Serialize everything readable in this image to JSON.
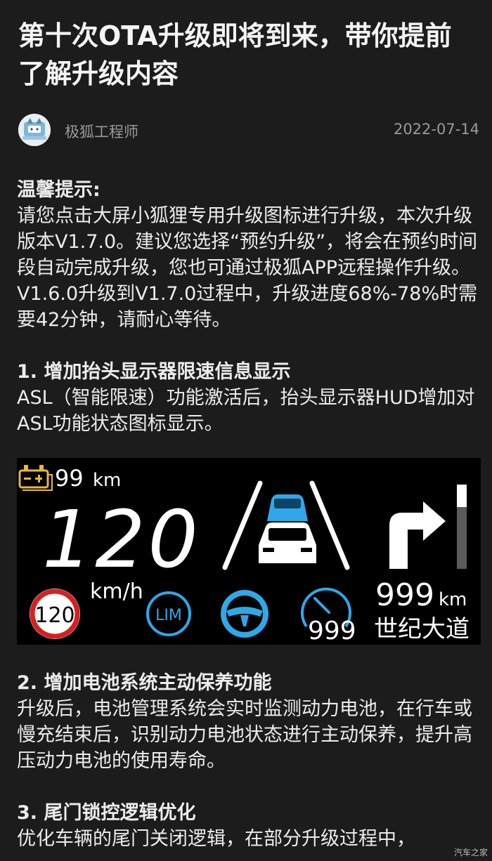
{
  "article": {
    "title": "第十次OTA升级即将到来，带你提前了解升级内容",
    "author": "极狐工程师",
    "date": "2022-07-14"
  },
  "tips": {
    "heading": "温馨提示:",
    "lines": [
      "请您点击大屏小狐狸专用升级图标进行升级，本次升级版本V1.7.0。建议您选择“预约升级”，将会在预约时间段自动完成升级，您也可通过极狐APP远程操作升级。",
      "V1.6.0升级到V1.7.0过程中，升级进度68%-78%时需要42分钟，请耐心等待。"
    ]
  },
  "sections": [
    {
      "heading": "1. 增加抬头显示器限速信息显示",
      "body": "ASL（智能限速）功能激活后，抬头显示器HUD增加对ASL功能状态图标显示。"
    },
    {
      "heading": "2. 增加电池系统主动保养功能",
      "body": "升级后，电池管理系统会实时监测动力电池，在行车或慢充结束后，识别动力电池状态进行主动保养，提升高压动力电池的使用寿命。"
    },
    {
      "heading": "3. 尾门锁控逻辑优化",
      "body": "优化车辆的尾门关闭逻辑，在部分升级过程中，"
    }
  ],
  "hud": {
    "range": "99",
    "range_unit": "km",
    "speed": "120",
    "speed_unit": "km/h",
    "limit_sign": "120",
    "lim_label": "LIM",
    "gauge_value": "999",
    "distance": "999",
    "distance_unit": "km",
    "road_name": "世纪大道",
    "accent_color": "#2ea8e8",
    "battery_color": "#e8b83a",
    "limit_ring_color": "#d42020"
  },
  "watermark": "汽车之家"
}
